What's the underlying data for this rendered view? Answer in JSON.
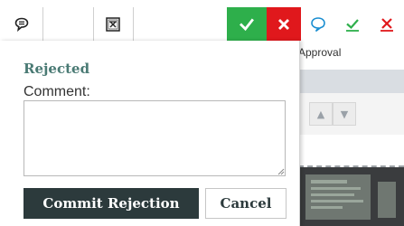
{
  "toolbar": {
    "icons": [
      "speech-bubble-icon",
      "expression-icon",
      "check-icon",
      "close-icon",
      "chat-bubble-icon",
      "check-icon",
      "close-icon"
    ]
  },
  "background": {
    "approval_label": "Approval"
  },
  "popup": {
    "title": "Rejected",
    "comment_label": "Comment:",
    "comment_value": "",
    "commit_label": "Commit Rejection",
    "cancel_label": "Cancel"
  },
  "colors": {
    "approve": "#2eaf4b",
    "reject": "#e0181c",
    "title": "#4a7a74",
    "commit_bg": "#2c3a3c"
  }
}
